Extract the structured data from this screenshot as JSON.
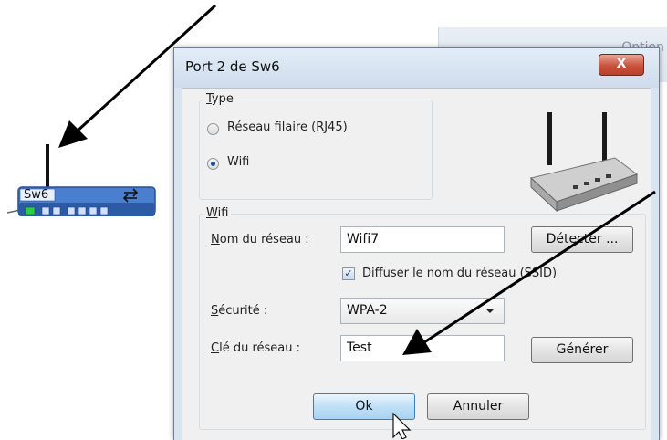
{
  "background": {
    "option_label": "Option"
  },
  "switch": {
    "name": "Sw6"
  },
  "dialog": {
    "title": "Port 2 de Sw6",
    "close_label": "X",
    "type_group": {
      "label_first": "T",
      "label_rest": "ype",
      "options": [
        {
          "label": "Réseau filaire (RJ45)",
          "selected": false
        },
        {
          "label": "Wifi",
          "selected": true
        }
      ]
    },
    "wifi_group": {
      "label_first": "W",
      "label_rest": "ifi",
      "network_name": {
        "label_first": "N",
        "label_rest": "om du réseau :",
        "value": "Wifi7"
      },
      "detect_button": "Détecter ...",
      "broadcast_ssid": {
        "label": "Diffuser le nom du réseau (SSID)",
        "checked": true
      },
      "security": {
        "label_first": "S",
        "label_rest": "écurité :",
        "value": "WPA-2"
      },
      "network_key": {
        "label_first": "C",
        "label_rest": "lé du réseau :",
        "value": "Test"
      },
      "generate_button": "Générer"
    },
    "ok_button": "Ok",
    "cancel_button": "Annuler"
  },
  "colors": {
    "dialog_frame": "#d9e4f1",
    "client": "#f0f0f0",
    "arrow": "#000000",
    "switch_body": "#3d6fc0",
    "port_active": "#2ecc40"
  }
}
